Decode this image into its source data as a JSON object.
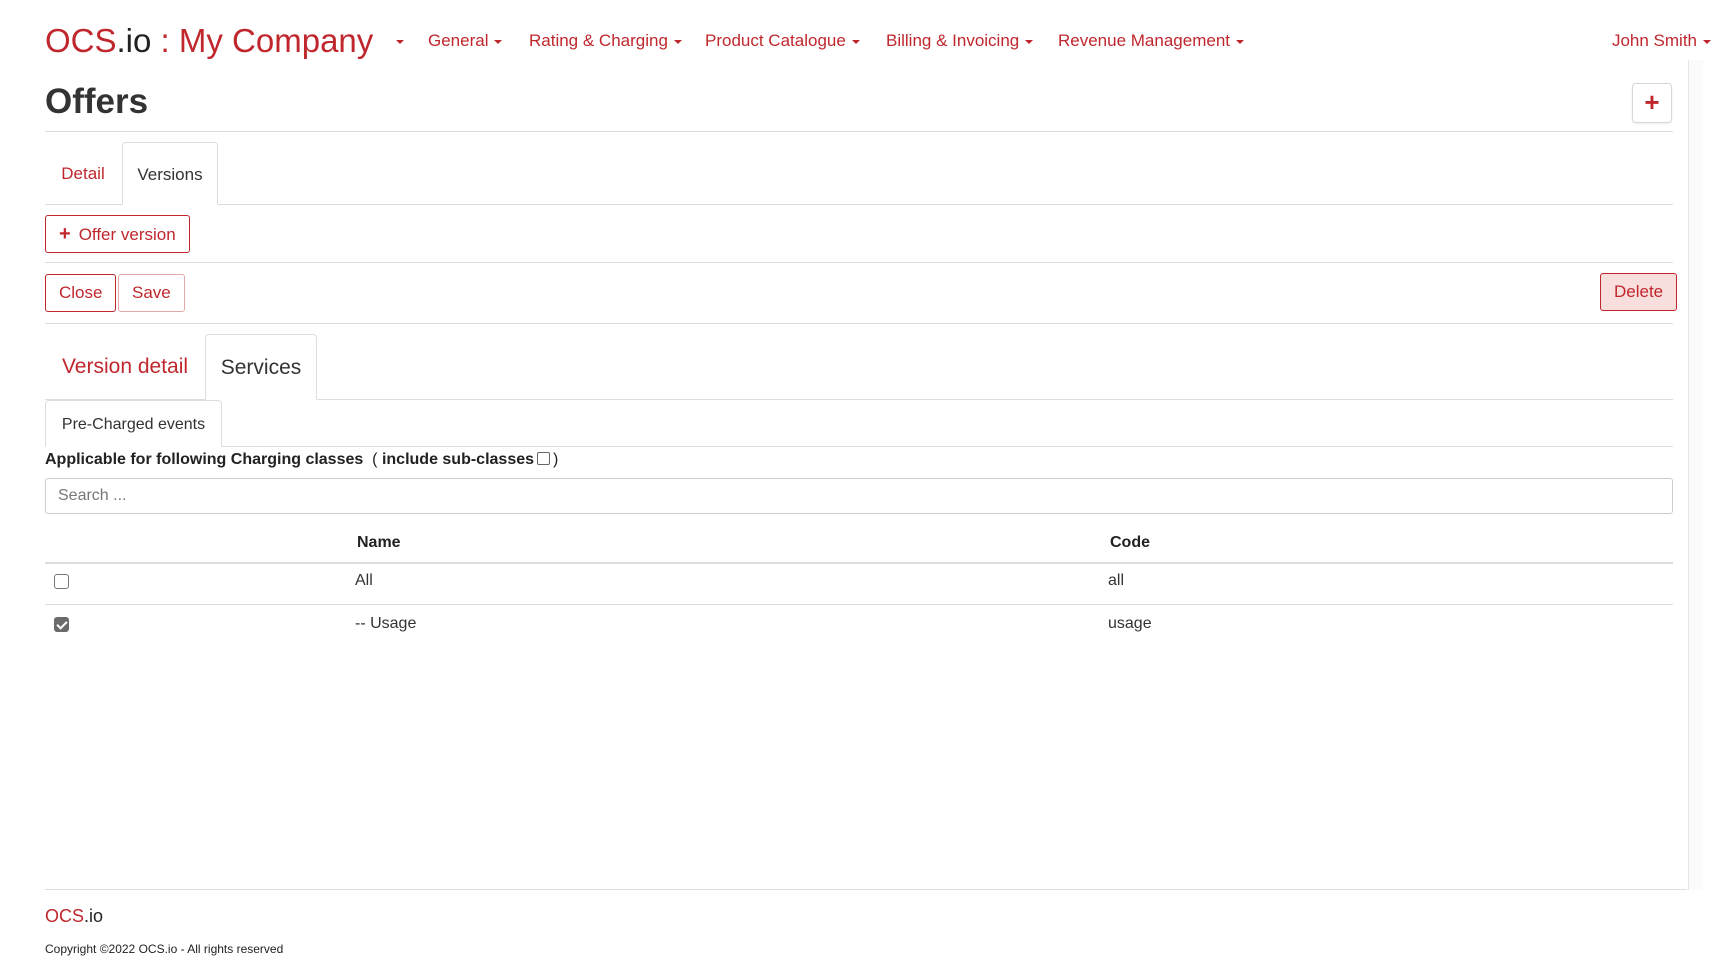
{
  "brand": {
    "name": "OCS",
    "suffix": ".io",
    "company": " : My Company"
  },
  "nav": {
    "items": [
      "General",
      "Rating & Charging",
      "Product Catalogue",
      "Billing & Invoicing",
      "Revenue Management"
    ],
    "user": "John Smith"
  },
  "page": {
    "title": "Offers",
    "add_button": "+"
  },
  "tabs": {
    "main": [
      {
        "label": "Detail"
      },
      {
        "label": "Versions",
        "active": true
      }
    ],
    "version": [
      {
        "label": "Version detail"
      },
      {
        "label": "Services",
        "active": true
      }
    ],
    "services": [
      {
        "label": "Pre-Charged events",
        "active": true
      }
    ]
  },
  "buttons": {
    "offer_version": "Offer version",
    "close": "Close",
    "save": "Save",
    "delete": "Delete"
  },
  "applicable": {
    "label": "Applicable for following Charging classes",
    "open_paren": "( include sub-classes",
    "close_paren": ")",
    "include_subclasses": false
  },
  "search": {
    "placeholder": "Search ..."
  },
  "table": {
    "headers": {
      "name": "Name",
      "code": "Code"
    },
    "rows": [
      {
        "checked": false,
        "name": "All",
        "code": "all"
      },
      {
        "checked": true,
        "name": "-- Usage",
        "code": "usage"
      }
    ]
  },
  "footer": {
    "brand_name": "OCS",
    "brand_suffix": ".io",
    "copyright": "Copyright ©2022 OCS.io - All rights reserved"
  },
  "colors": {
    "accent": "#c0272d",
    "border": "#dddddd",
    "text": "#333333"
  }
}
